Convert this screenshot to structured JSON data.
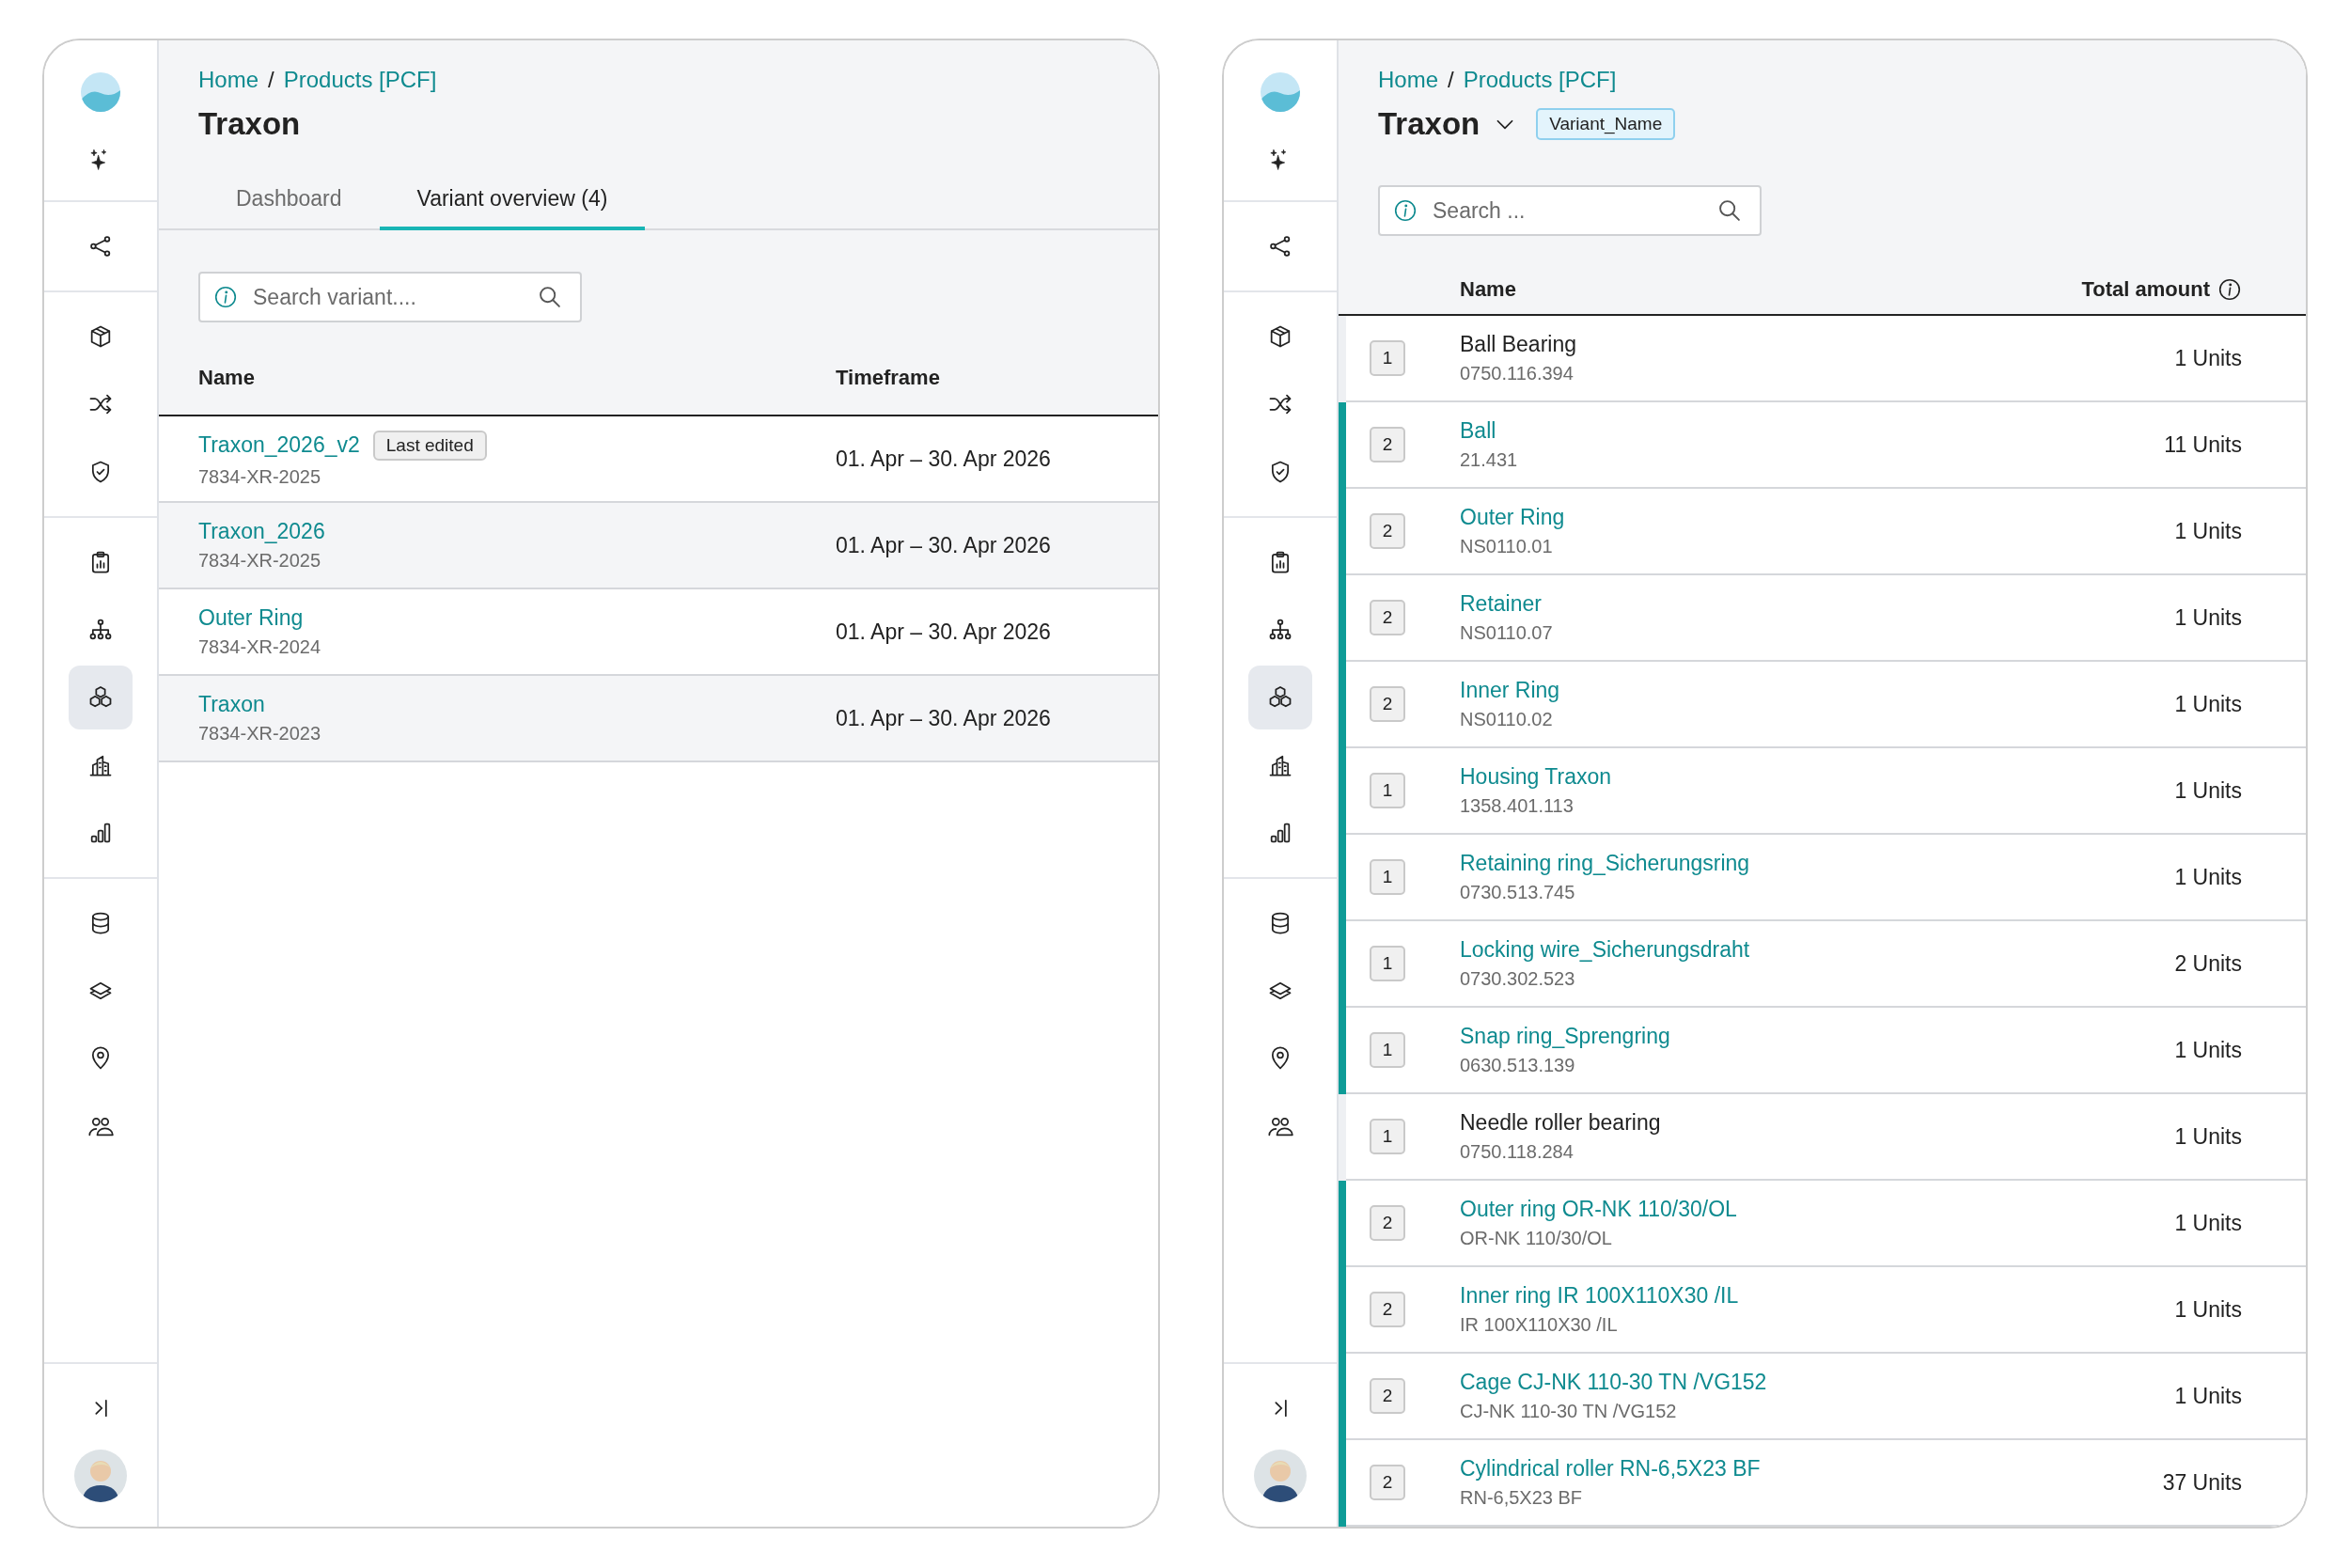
{
  "left_window": {
    "sidebar": {
      "items": [
        {
          "selected": false
        },
        {
          "selected": false
        },
        {
          "selected": false
        },
        {
          "selected": false
        },
        {
          "selected": false
        },
        {
          "selected": false
        },
        {
          "selected": false
        },
        {
          "selected": true
        },
        {
          "selected": false
        },
        {
          "selected": false
        },
        {
          "selected": false
        },
        {
          "selected": false
        },
        {
          "selected": false
        },
        {
          "selected": false
        }
      ]
    },
    "breadcrumb": {
      "items": [
        "Home",
        "Products [PCF]"
      ],
      "separator": "/"
    },
    "title": "Traxon",
    "tabs": [
      {
        "label": "Dashboard",
        "selected": false
      },
      {
        "label": "Variant overview (4)",
        "selected": true
      }
    ],
    "search": {
      "placeholder": "Search variant...."
    },
    "table": {
      "columns": [
        "Name",
        "Timeframe"
      ],
      "rows": [
        {
          "name": "Traxon_2026_v2",
          "badge": "Last edited",
          "code": "7834-XR-2025",
          "timeframe": "01. Apr – 30. Apr 2026"
        },
        {
          "name": "Traxon_2026",
          "code": "7834-XR-2025",
          "timeframe": "01. Apr – 30. Apr 2026"
        },
        {
          "name": "Outer Ring",
          "code": "7834-XR-2024",
          "timeframe": "01. Apr – 30. Apr 2026"
        },
        {
          "name": "Traxon",
          "code": "7834-XR-2023",
          "timeframe": "01. Apr – 30. Apr 2026"
        }
      ]
    }
  },
  "right_window": {
    "sidebar": {
      "items": [
        {
          "selected": false
        },
        {
          "selected": false
        },
        {
          "selected": false
        },
        {
          "selected": false
        },
        {
          "selected": false
        },
        {
          "selected": false
        },
        {
          "selected": false
        },
        {
          "selected": true
        },
        {
          "selected": false
        },
        {
          "selected": false
        },
        {
          "selected": false
        },
        {
          "selected": false
        },
        {
          "selected": false
        },
        {
          "selected": false
        }
      ]
    },
    "breadcrumb": {
      "items": [
        "Home",
        "Products [PCF]"
      ],
      "separator": "/"
    },
    "title": "Traxon",
    "variant_chip": "Variant_Name",
    "search": {
      "placeholder": "Search ..."
    },
    "table": {
      "columns": [
        "Name",
        "Total amount"
      ],
      "rows": [
        {
          "level": "1",
          "name": "Ball Bearing",
          "code": "0750.116.394",
          "amount": "1 Units",
          "highlighted": false
        },
        {
          "level": "2",
          "name": "Ball",
          "code": "21.431",
          "amount": "11 Units",
          "highlighted": true
        },
        {
          "level": "2",
          "name": "Outer Ring",
          "code": "NS0110.01",
          "amount": "1 Units",
          "highlighted": true
        },
        {
          "level": "2",
          "name": "Retainer",
          "code": "NS0110.07",
          "amount": "1 Units",
          "highlighted": true
        },
        {
          "level": "2",
          "name": "Inner Ring",
          "code": "NS0110.02",
          "amount": "1 Units",
          "highlighted": true
        },
        {
          "level": "1",
          "name": "Housing Traxon",
          "code": "1358.401.113",
          "amount": "1 Units",
          "highlighted": true
        },
        {
          "level": "1",
          "name": "Retaining ring_Sicherungsring",
          "code": "0730.513.745",
          "amount": "1 Units",
          "highlighted": true
        },
        {
          "level": "1",
          "name": "Locking wire_Sicherungsdraht",
          "code": "0730.302.523",
          "amount": "2 Units",
          "highlighted": true
        },
        {
          "level": "1",
          "name": "Snap ring_Sprengring",
          "code": "0630.513.139",
          "amount": "1 Units",
          "highlighted": true
        },
        {
          "level": "1",
          "name": "Needle roller bearing",
          "code": "0750.118.284",
          "amount": "1 Units",
          "highlighted": false
        },
        {
          "level": "2",
          "name": "Outer ring OR-NK 110/30/OL",
          "code": "OR-NK 110/30/OL",
          "amount": "1 Units",
          "highlighted": true
        },
        {
          "level": "2",
          "name": "Inner ring IR 100X110X30 /IL",
          "code": "IR 100X110X30 /IL",
          "amount": "1 Units",
          "highlighted": true
        },
        {
          "level": "2",
          "name": "Cage CJ-NK 110-30 TN /VG152",
          "code": "CJ-NK 110-30 TN /VG152",
          "amount": "1 Units",
          "highlighted": true
        },
        {
          "level": "2",
          "name": "Cylindrical roller RN-6,5X23 BF",
          "code": "RN-6,5X23 BF",
          "amount": "37 Units",
          "highlighted": true
        }
      ]
    }
  }
}
